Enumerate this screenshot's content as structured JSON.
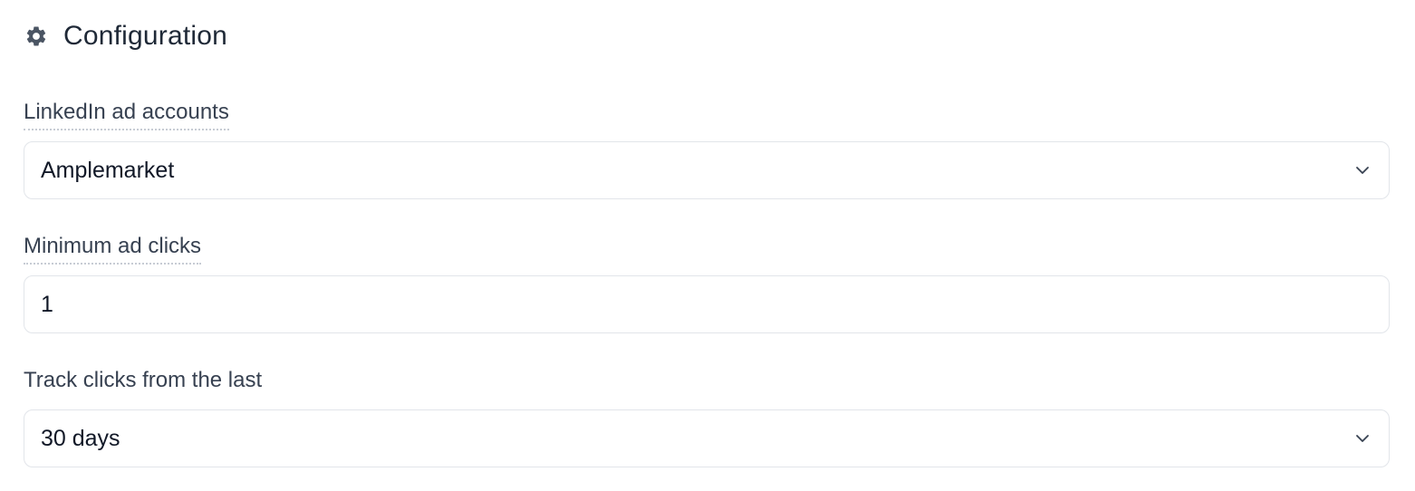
{
  "header": {
    "icon": "gear-icon",
    "title": "Configuration"
  },
  "fields": {
    "ad_accounts": {
      "label": "LinkedIn ad accounts",
      "value": "Amplemarket",
      "type": "select"
    },
    "min_clicks": {
      "label": "Minimum ad clicks",
      "value": "1",
      "type": "input"
    },
    "track_window": {
      "label": "Track clicks from the last",
      "value": "30 days",
      "type": "select"
    }
  },
  "colors": {
    "text": "#1f2937",
    "label": "#374151",
    "border": "#e2e5ea",
    "icon": "#4b5563"
  }
}
